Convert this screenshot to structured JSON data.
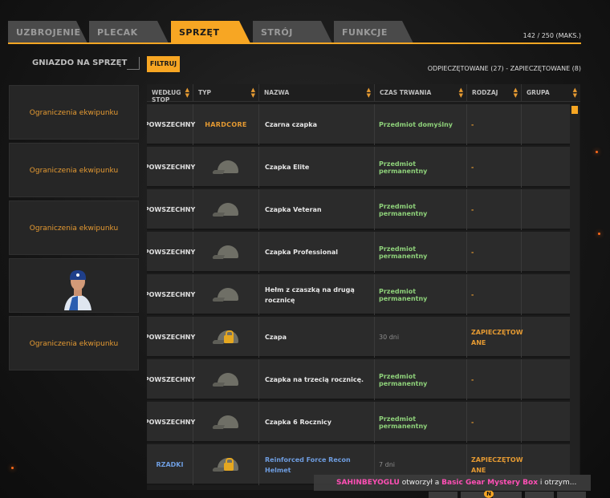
{
  "tabs": [
    {
      "label": "UZBROJENIE",
      "active": false
    },
    {
      "label": "PLECAK",
      "active": false
    },
    {
      "label": "SPRZĘT",
      "active": true
    },
    {
      "label": "STRÓJ",
      "active": false
    },
    {
      "label": "FUNKCJE",
      "active": false
    }
  ],
  "capacity": "142 / 250 (MAKS.)",
  "slot_title": "GNIAZDO NA SPRZĘT",
  "filter_label": "FILTRUJ",
  "counts": "ODPIECZĘTOWANE (27) - ZAPIECZĘTOWANE (8)",
  "slots": [
    {
      "label": "Ograniczenia ekwipunku",
      "type": "text"
    },
    {
      "label": "Ograniczenia ekwipunku",
      "type": "text"
    },
    {
      "label": "Ograniczenia ekwipunku",
      "type": "text"
    },
    {
      "label": "",
      "type": "avatar"
    },
    {
      "label": "Ograniczenia ekwipunku",
      "type": "text"
    }
  ],
  "columns": [
    "WEDŁUG STOP",
    "TYP",
    "NAZWA",
    "CZAS TRWANIA",
    "RODZAJ",
    "GRUPA"
  ],
  "items": [
    {
      "rarity": "POWSZECHNY",
      "type_label": "HARDCORE",
      "icon": "none",
      "name": "Czarna czapka",
      "duration": "Przedmiot domyślny",
      "kind": "-",
      "group": ""
    },
    {
      "rarity": "POWSZECHNY",
      "type_label": "",
      "icon": "cap-icon",
      "name": "Czapka Elite",
      "duration": "Przedmiot permanentny",
      "kind": "-",
      "group": ""
    },
    {
      "rarity": "POWSZECHNY",
      "type_label": "",
      "icon": "cap-icon",
      "name": "Czapka Veteran",
      "duration": "Przedmiot permanentny",
      "kind": "-",
      "group": ""
    },
    {
      "rarity": "POWSZECHNY",
      "type_label": "",
      "icon": "cap-icon",
      "name": "Czapka Professional",
      "duration": "Przedmiot permanentny",
      "kind": "-",
      "group": ""
    },
    {
      "rarity": "POWSZECHNY",
      "type_label": "",
      "icon": "cap-icon",
      "name": "Hełm z czaszką na drugą rocznicę",
      "duration": "Przedmiot permanentny",
      "kind": "-",
      "group": ""
    },
    {
      "rarity": "POWSZECHNY",
      "type_label": "",
      "icon": "locked-cap-icon",
      "name": "Czapa",
      "duration": "30 dni",
      "kind": "ZAPIECZĘTOW ANE",
      "group": ""
    },
    {
      "rarity": "POWSZECHNY",
      "type_label": "",
      "icon": "cap-icon",
      "name": "Czapka na trzecią rocznicę.",
      "duration": "Przedmiot permanentny",
      "kind": "-",
      "group": ""
    },
    {
      "rarity": "POWSZECHNY",
      "type_label": "",
      "icon": "cap-icon",
      "name": "Czapka 6 Rocznicy",
      "duration": "Przedmiot permanentny",
      "kind": "-",
      "group": ""
    },
    {
      "rarity": "RZADKI",
      "type_label": "",
      "icon": "locked-cap-icon",
      "name": "Reinforced Force Recon Helmet",
      "duration": "7 dni",
      "kind": "ZAPIECZĘTOW ANE",
      "group": ""
    }
  ],
  "toast": {
    "player": "SAHINBEYOGLU",
    "action": " otworzył a ",
    "box": "Basic Gear Mystery Box",
    "rest": " i otrzym..."
  },
  "badge": "N",
  "colors": {
    "accent": "#f7a623",
    "permanent": "#8ed17a",
    "rare": "#6e9de0",
    "sealed": "#e59a32"
  }
}
